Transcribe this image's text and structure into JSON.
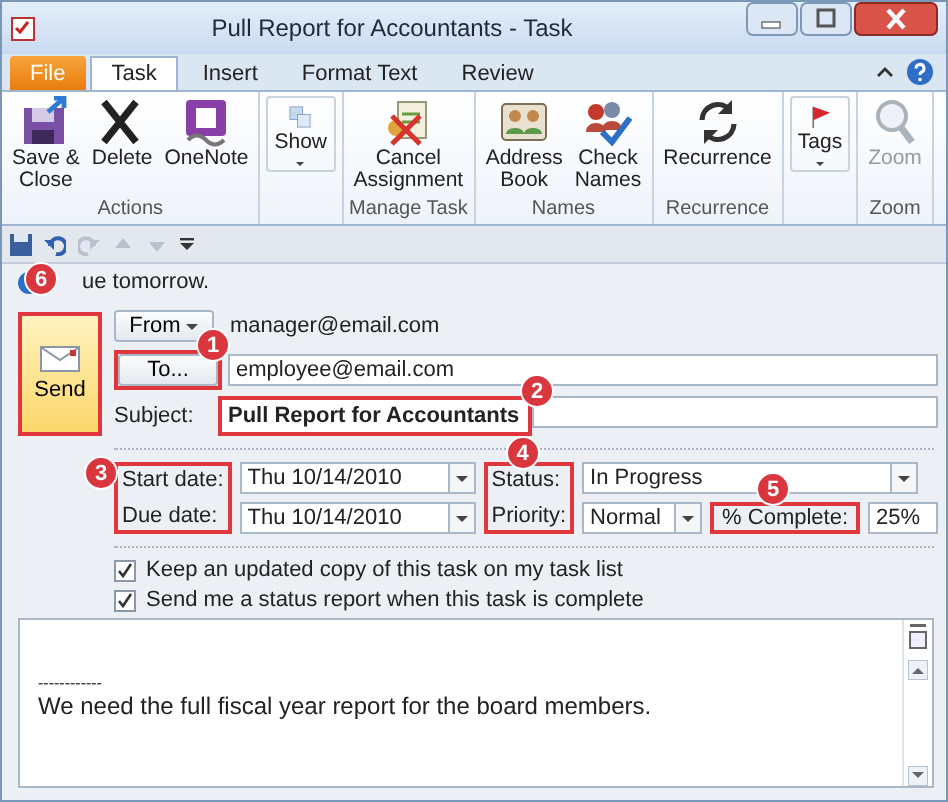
{
  "window": {
    "title": "Pull Report for Accountants  -  Task"
  },
  "tabs": [
    {
      "label": "File",
      "kind": "file",
      "selected": false
    },
    {
      "label": "Task",
      "kind": "tab",
      "selected": true
    },
    {
      "label": "Insert",
      "kind": "tab",
      "selected": false
    },
    {
      "label": "Format Text",
      "kind": "tab",
      "selected": false
    },
    {
      "label": "Review",
      "kind": "tab",
      "selected": false
    }
  ],
  "ribbon_groups": [
    {
      "label": "Actions",
      "buttons": [
        {
          "label": "Save &\nClose",
          "disabled": false,
          "dropdown": false
        },
        {
          "label": "Delete",
          "disabled": false,
          "dropdown": false
        },
        {
          "label": "OneNote",
          "disabled": false,
          "dropdown": false
        }
      ]
    },
    {
      "buttons": [
        {
          "label": "Show",
          "disabled": false,
          "dropdown": true
        }
      ]
    },
    {
      "label": "Manage Task",
      "buttons": [
        {
          "label": "Cancel\nAssignment",
          "disabled": false,
          "dropdown": false
        }
      ]
    },
    {
      "label": "Names",
      "buttons": [
        {
          "label": "Address\nBook",
          "disabled": false,
          "dropdown": false
        },
        {
          "label": "Check\nNames",
          "disabled": false,
          "dropdown": false
        }
      ]
    },
    {
      "label": "Recurrence",
      "buttons": [
        {
          "label": "Recurrence",
          "disabled": false,
          "dropdown": false
        }
      ]
    },
    {
      "buttons": [
        {
          "label": "Tags",
          "disabled": false,
          "dropdown": true
        }
      ]
    },
    {
      "label": "Zoom",
      "buttons": [
        {
          "label": "Zoom",
          "disabled": true,
          "dropdown": false
        }
      ]
    }
  ],
  "info_bar": {
    "text": "ue tomorrow."
  },
  "send": {
    "label": "Send",
    "callout": "6"
  },
  "from": {
    "label": "From",
    "value": "manager@email.com"
  },
  "to": {
    "label": "To...",
    "value": "employee@email.com",
    "callout": "1"
  },
  "subject": {
    "label": "Subject:",
    "value": "Pull Report for Accountants",
    "callout": "2"
  },
  "dates": {
    "callout": "3",
    "start_label": "Start date:",
    "start_value": "Thu 10/14/2010",
    "due_label": "Due date:",
    "due_value": "Thu 10/14/2010"
  },
  "status": {
    "callout": "4",
    "status_label": "Status:",
    "status_value": "In Progress",
    "priority_label": "Priority:",
    "priority_value": "Normal"
  },
  "complete": {
    "callout": "5",
    "label": "% Complete:",
    "value": "25%"
  },
  "options": [
    {
      "label": "Keep an updated copy of this task on my task list",
      "checked": true
    },
    {
      "label": "Send me a status report when this task is complete",
      "checked": true
    }
  ],
  "body": [
    "------------",
    "We need the full fiscal year report for the board members."
  ]
}
